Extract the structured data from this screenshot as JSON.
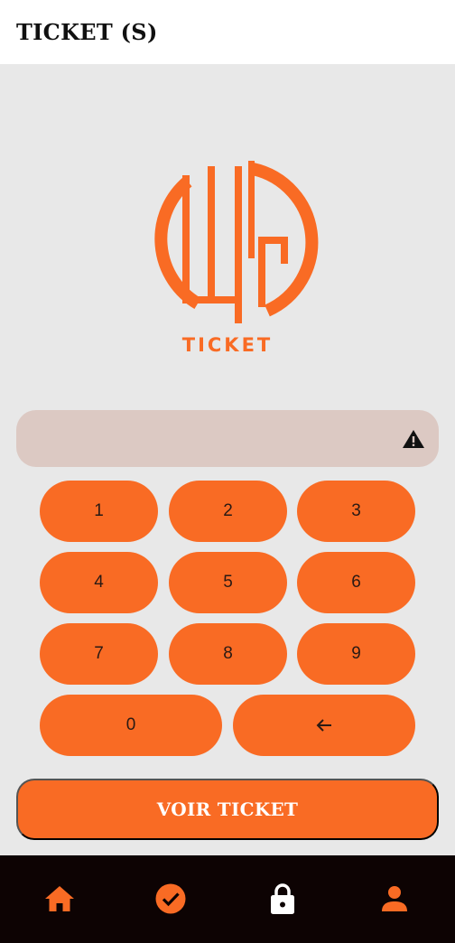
{
  "header": {
    "title": "TICKET (S)"
  },
  "logo": {
    "text": "TICKET"
  },
  "input": {
    "value": "",
    "status_icon": "warning-icon"
  },
  "keypad": {
    "keys": [
      "1",
      "2",
      "3",
      "4",
      "5",
      "6",
      "7",
      "8",
      "9",
      "0"
    ],
    "backspace_icon": "backspace-arrow-icon"
  },
  "actions": {
    "submit_label": "VOIR TICKET"
  },
  "nav": {
    "items": [
      "home-icon",
      "check-circle-icon",
      "lock-icon",
      "person-icon"
    ]
  },
  "colors": {
    "accent": "#f96b24",
    "app_bar": "#ffffff",
    "background": "#e8e8e8",
    "input_bg": "#dcc9c3",
    "nav_bg": "#0d0303",
    "key_text": "#2a1a14"
  }
}
